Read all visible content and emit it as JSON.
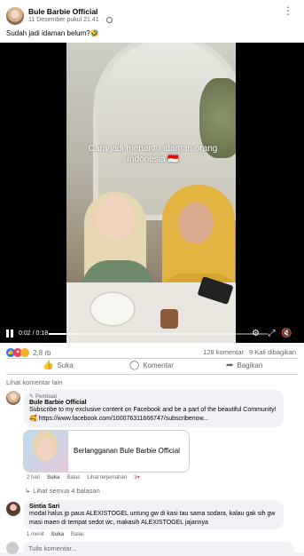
{
  "post": {
    "author": "Bule Barbie Official",
    "timestamp": "11 Desember pukul 21.41",
    "caption": "Sudah jadi idaman belum?🤣"
  },
  "video": {
    "overlay_text": "Cara jadi menantu idaman orang Indonesia 🇮🇩",
    "time_display": "0:02 / 0:18",
    "progress": 0.11
  },
  "reactions": {
    "count": "2,8 rb",
    "comments": "128 komentar",
    "shares": "9 Kali dibagikan"
  },
  "actions": {
    "like": "Suka",
    "comment": "Komentar",
    "share": "Bagikan"
  },
  "view_more_comments": "Lihat komentar lain",
  "comments": [
    {
      "badge": "Pembuat",
      "name": "Bule Barbie Official",
      "text": "Subscribe to my exclusive content on Facebook and be a part of the beautiful Community!🥰 https://www.facebook.com/100076311666747/subscribenow...",
      "subscribe_card": "Berlangganan Bule Barbie Official",
      "time": "2 hari",
      "like": "Suka",
      "reply": "Balas",
      "translate": "Lihat terjemahan",
      "reaction_count": "3"
    },
    {
      "name": "Sintia Sari",
      "text": "modal halus jp paus ALEXISTOGEL untung gw di kasi tau sama sodara, kalau gak sih gw masi maen di tempat sedot wc, makasih ALEXISTOGEL jajannya",
      "time": "1 menit",
      "like": "Suka",
      "reply": "Balas"
    }
  ],
  "replies_link": "Lihat semua 4 balasan",
  "write_comment_placeholder": "Tulis komentar..."
}
